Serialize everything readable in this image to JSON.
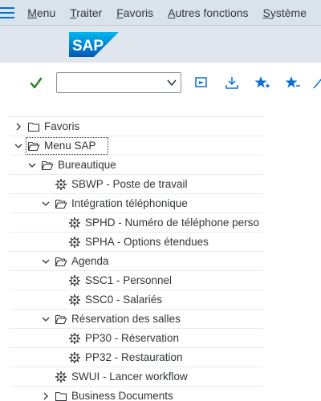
{
  "menubar": {
    "items": [
      {
        "accel": "M",
        "rest": "enu"
      },
      {
        "accel": "T",
        "rest": "raiter"
      },
      {
        "accel": "F",
        "rest": "avoris"
      },
      {
        "accel": "A",
        "rest": "utres fonctions"
      },
      {
        "accel": "S",
        "rest": "ystème"
      }
    ]
  },
  "header": {
    "logo_text": "SAP",
    "brand_color": "#0a6ed1"
  },
  "toolbar": {
    "command_field_value": "",
    "icons": [
      "enter-check-icon",
      "dropdown-chevron-icon",
      "add-to-favorites-icon",
      "download-icon",
      "create-favorite-star-icon",
      "delete-favorite-star-icon",
      "edit-icon"
    ]
  },
  "tree": {
    "nodes": [
      {
        "label": "Favoris",
        "icon": "folder-closed-icon",
        "expanded": false
      },
      {
        "label": "Menu SAP",
        "icon": "folder-open-icon",
        "expanded": true
      },
      {
        "label": "Bureautique",
        "icon": "folder-open-icon",
        "expanded": true
      },
      {
        "label": "SBWP - Poste de travail",
        "icon": "transaction-icon"
      },
      {
        "label": "Intégration téléphonique",
        "icon": "folder-open-icon",
        "expanded": true
      },
      {
        "label": "SPHD - Numéro de téléphone perso",
        "icon": "transaction-icon"
      },
      {
        "label": "SPHA - Options étendues",
        "icon": "transaction-icon"
      },
      {
        "label": "Agenda",
        "icon": "folder-open-icon",
        "expanded": true
      },
      {
        "label": "SSC1 - Personnel",
        "icon": "transaction-icon"
      },
      {
        "label": "SSC0 - Salariés",
        "icon": "transaction-icon"
      },
      {
        "label": "Réservation des salles",
        "icon": "folder-open-icon",
        "expanded": true
      },
      {
        "label": "PP30 - Réservation",
        "icon": "transaction-icon"
      },
      {
        "label": "PP32 - Restauration",
        "icon": "transaction-icon"
      },
      {
        "label": "SWUI - Lancer workflow",
        "icon": "transaction-icon"
      },
      {
        "label": "Business Documents",
        "icon": "folder-closed-icon",
        "expanded": false
      }
    ]
  }
}
